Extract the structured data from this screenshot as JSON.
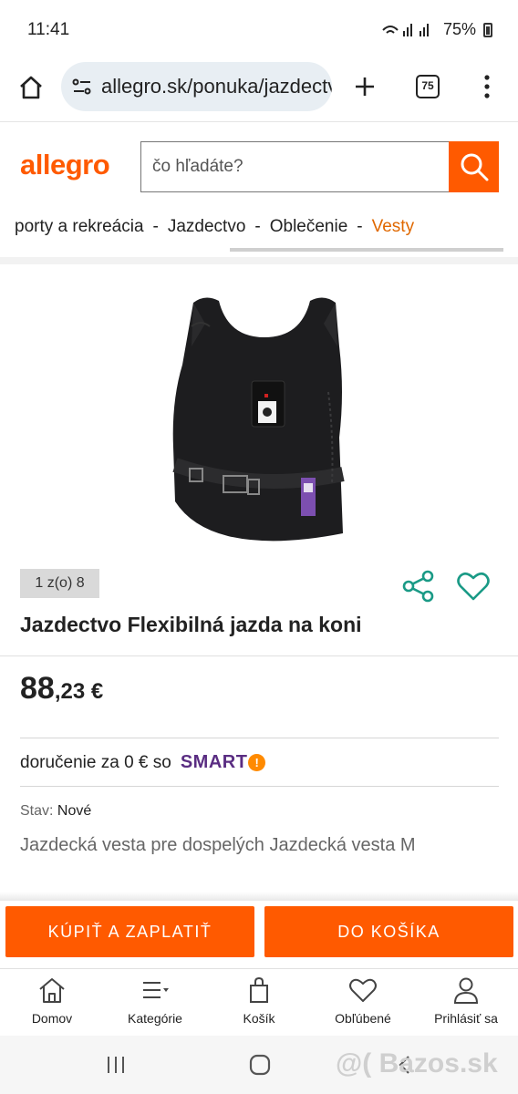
{
  "status_bar": {
    "time": "11:41",
    "battery": "75%"
  },
  "browser": {
    "url": "allegro.sk/ponuka/jazdectvo",
    "tab_count": "75"
  },
  "header": {
    "logo": "allegro",
    "search_placeholder": "čo hľadáte?",
    "brand_color": "#ff5a00"
  },
  "breadcrumbs": [
    "porty a rekreácia",
    "Jazdectvo",
    "Oblečenie",
    "Vesty"
  ],
  "breadcrumb_separator": "-",
  "product": {
    "image_counter": "1 z(o) 8",
    "title": "Jazdectvo Flexibilná jazda na koni",
    "price_whole": "88",
    "price_fraction": ",23 €",
    "delivery_text": "doručenie za 0 € so",
    "smart_label": "SMART",
    "smart_mark": "!",
    "condition_label": "Stav:",
    "condition_value": "Nové",
    "description": "Jazdecká vesta pre dospelých Jazdecká vesta M"
  },
  "actions": {
    "buy_now": "KÚPIŤ A ZAPLATIŤ",
    "add_to_cart": "DO KOŠÍKA"
  },
  "bottom_nav": [
    {
      "label": "Domov",
      "icon": "home-icon"
    },
    {
      "label": "Kategórie",
      "icon": "categories-icon"
    },
    {
      "label": "Košík",
      "icon": "cart-icon"
    },
    {
      "label": "Obľúbené",
      "icon": "heart-icon"
    },
    {
      "label": "Prihlásiť sa",
      "icon": "user-icon"
    }
  ],
  "watermark": "@( Bazos.sk"
}
